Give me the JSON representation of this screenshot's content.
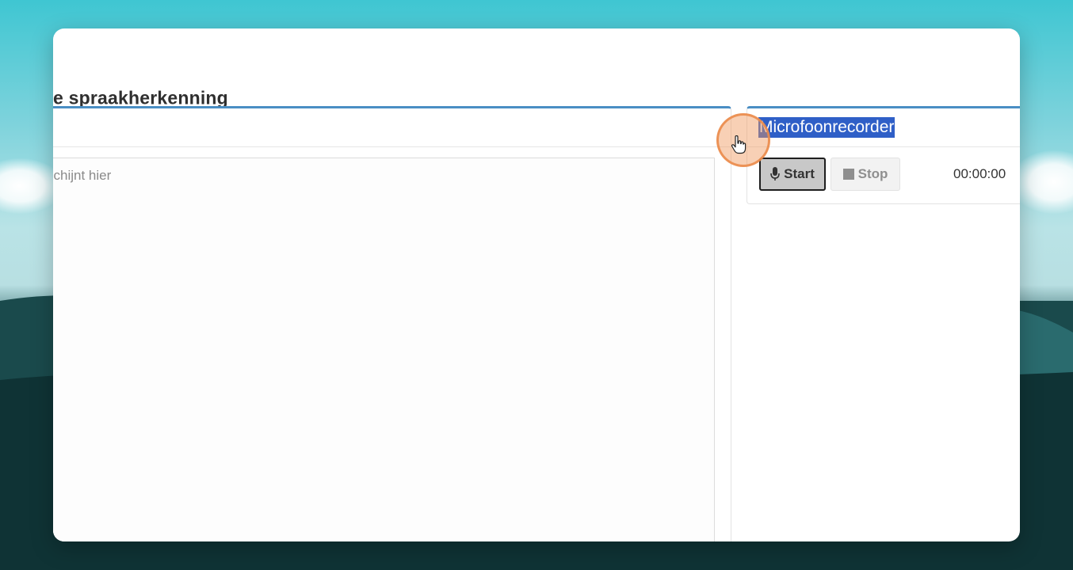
{
  "page": {
    "title": "e spraakherkenning"
  },
  "transcript": {
    "placeholder": "schijnt hier"
  },
  "recorder": {
    "title": "Microfoonrecorder",
    "start_label": "Start",
    "stop_label": "Stop",
    "timer": "00:00:00"
  },
  "colors": {
    "accent": "#4a8ec4",
    "selection": "#2f5fc7",
    "click_highlight": "#f0965a"
  },
  "icons": {
    "start": "microphone-icon",
    "stop": "stop-square-icon",
    "cursor": "hand-pointer-icon"
  }
}
